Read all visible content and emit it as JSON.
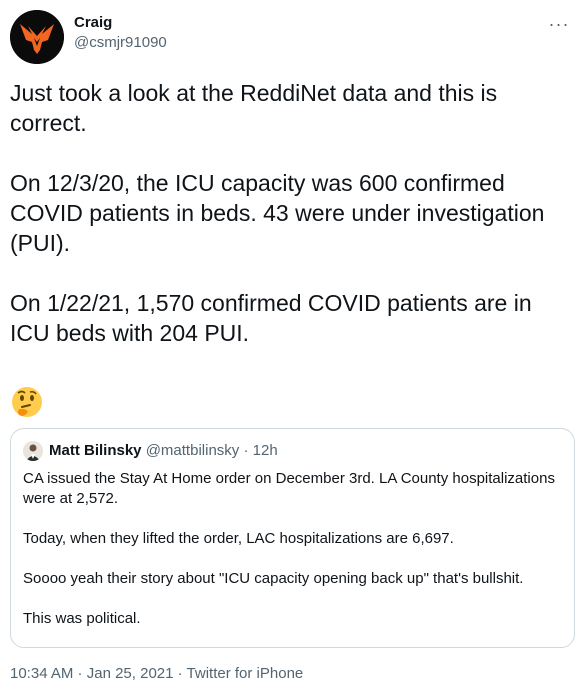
{
  "author": {
    "display_name": "Craig",
    "handle": "@csmjr91090",
    "avatar_icon": "orange-phoenix-logo-icon"
  },
  "more_icon": "more-options-icon",
  "tweet": {
    "text": "Just took a look at the ReddiNet data and this is correct.\n\nOn 12/3/20, the ICU capacity was 600 confirmed COVID patients in beds. 43 were under investigation (PUI).\n\nOn 1/22/21, 1,570 confirmed COVID patients are in ICU beds with 204 PUI.",
    "emoji": "thinking-face-emoji"
  },
  "quoted_tweet": {
    "display_name": "Matt Bilinsky",
    "handle": "@mattbilinsky",
    "separator": "·",
    "time": "12h",
    "text": "CA issued the Stay At Home order on December 3rd. LA County hospitalizations were at 2,572.\n\nToday, when they lifted the order, LAC hospitalizations are 6,697.\n\nSoooo yeah their story about \"ICU capacity opening back up\" that's bullshit.\n\nThis was political."
  },
  "footer": {
    "time": "10:34 AM",
    "separator1": " · ",
    "date": "Jan 25, 2021",
    "separator2": " · ",
    "source": "Twitter for iPhone"
  },
  "colors": {
    "text": "#0f1419",
    "secondary": "#536471",
    "border": "#cfd9de",
    "logo_orange": "#f26522"
  }
}
